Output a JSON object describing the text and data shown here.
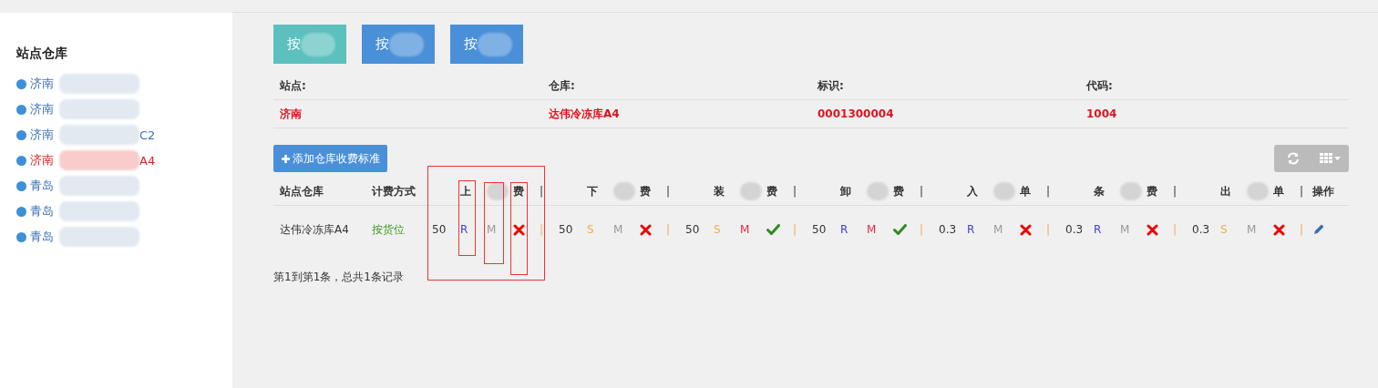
{
  "sidebar": {
    "title": "站点仓库",
    "items": [
      {
        "city": "济南",
        "selected": false
      },
      {
        "city": "济南",
        "selected": false
      },
      {
        "city": "济南",
        "suffix": "C2",
        "selected": false
      },
      {
        "city": "济南",
        "suffix": "A4",
        "selected": true
      },
      {
        "city": "青岛",
        "selected": false
      },
      {
        "city": "青岛",
        "selected": false
      },
      {
        "city": "青岛",
        "selected": false
      }
    ]
  },
  "mode_buttons": [
    {
      "label": "按",
      "color": "#5bc0be"
    },
    {
      "label": "按",
      "color": "#4a90d9"
    },
    {
      "label": "按",
      "color": "#4a90d9"
    }
  ],
  "info": [
    {
      "label": "站点:",
      "value": "济南"
    },
    {
      "label": "仓库:",
      "value": "达伟冷冻库A4"
    },
    {
      "label": "标识:",
      "value": "0001300004"
    },
    {
      "label": "代码:",
      "value": "1004"
    }
  ],
  "add_button": {
    "label": "添加仓库收费标准"
  },
  "table": {
    "columns": [
      "站点仓库",
      "计费方式"
    ],
    "groups": [
      {
        "first": "上",
        "last": "费",
        "sep": "|"
      },
      {
        "first": "下",
        "last": "费",
        "sep": "|"
      },
      {
        "first": "装",
        "last": "费",
        "sep": "|"
      },
      {
        "first": "卸",
        "last": "费",
        "sep": "|"
      },
      {
        "first": "入",
        "last": "单",
        "sep": "|"
      },
      {
        "first": "条",
        "last": "费",
        "sep": "|"
      },
      {
        "first": "出",
        "last": "单",
        "sep": "|"
      }
    ],
    "action": "操作",
    "rows": [
      {
        "warehouse": "达伟冷冻库A4",
        "method": "按货位",
        "fees": [
          {
            "value": "50",
            "mode": "R",
            "color": "#4040d0",
            "m": "M",
            "m_on": false,
            "charged": false,
            "sep": "|"
          },
          {
            "value": "50",
            "mode": "S",
            "color": "#f0ad4e",
            "m": "M",
            "m_on": false,
            "charged": false,
            "sep": "|"
          },
          {
            "value": "50",
            "mode": "S",
            "color": "#f0ad4e",
            "m": "M",
            "m_on": true,
            "charged": true,
            "sep": "|"
          },
          {
            "value": "50",
            "mode": "R",
            "color": "#4040d0",
            "m": "M",
            "m_on": true,
            "charged": true,
            "sep": "|"
          },
          {
            "value": "0.3",
            "mode": "R",
            "color": "#4040d0",
            "m": "M",
            "m_on": false,
            "charged": false,
            "sep": "|"
          },
          {
            "value": "0.3",
            "mode": "R",
            "color": "#4040d0",
            "m": "M",
            "m_on": false,
            "charged": false,
            "sep": "|"
          },
          {
            "value": "0.3",
            "mode": "S",
            "color": "#f0ad4e",
            "m": "M",
            "m_on": false,
            "charged": false,
            "sep": "|"
          }
        ]
      }
    ]
  },
  "footer": "第1到第1条，总共1条记录"
}
